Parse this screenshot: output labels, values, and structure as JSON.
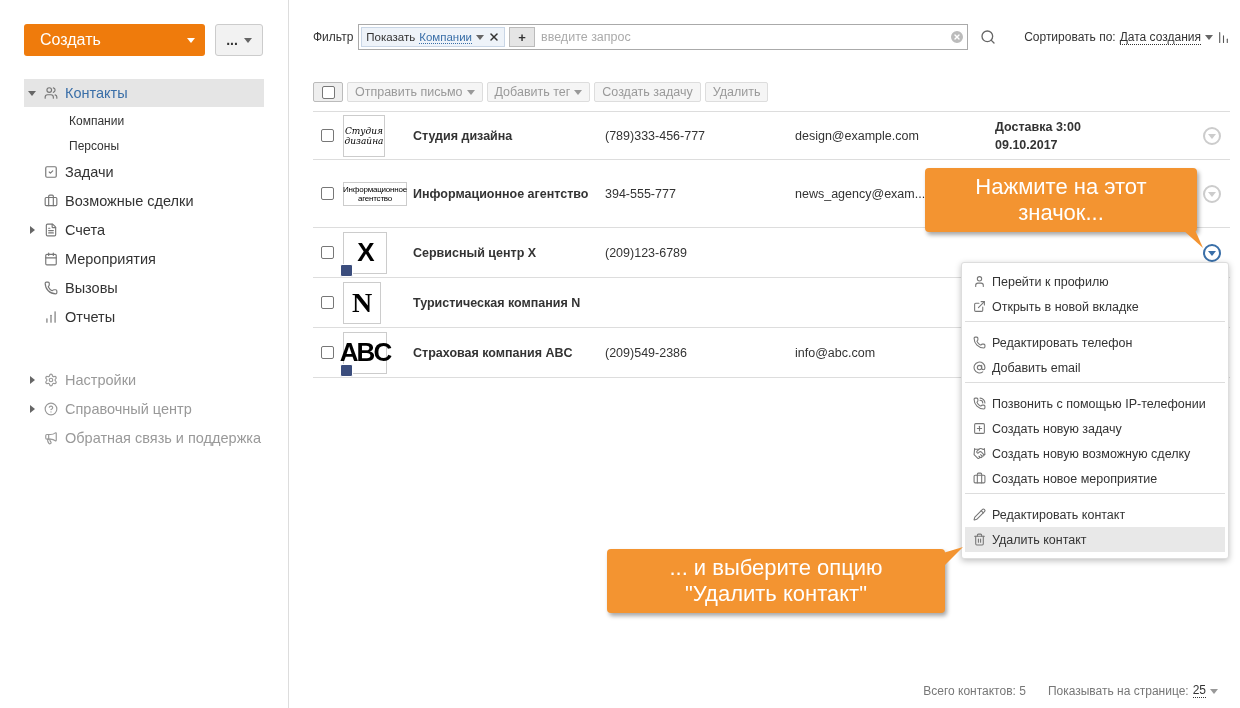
{
  "sidebar": {
    "create_button": "Создать",
    "more_button": "...",
    "sections": [
      {
        "dimmed": false,
        "items": [
          {
            "label": "Контакты",
            "selected": true,
            "expanded": true,
            "children": [
              {
                "label": "Компании",
                "selected": false
              },
              {
                "label": "Персоны",
                "selected": false
              }
            ]
          },
          {
            "label": "Задачи",
            "selected": false
          },
          {
            "label": "Возможные сделки",
            "selected": false
          },
          {
            "label": "Счета",
            "selected": false,
            "expanded": false
          },
          {
            "label": "Мероприятия",
            "selected": false
          },
          {
            "label": "Вызовы",
            "selected": false
          },
          {
            "label": "Отчеты",
            "selected": false
          }
        ]
      },
      {
        "dimmed": true,
        "items": [
          {
            "label": "Настройки",
            "selected": false,
            "expanded": false
          },
          {
            "label": "Справочный центр",
            "selected": false,
            "expanded": false
          },
          {
            "label": "Обратная связь и поддержка",
            "selected": false
          }
        ]
      }
    ]
  },
  "filter": {
    "label": "Фильтр",
    "tag": {
      "label": "Показать",
      "value": "Компании"
    },
    "add_button": "+",
    "placeholder": "введите запрос"
  },
  "sort": {
    "label": "Сортировать по:",
    "value": "Дата создания"
  },
  "toolbar": {
    "select_all": {
      "checked": false
    },
    "buttons": [
      {
        "label": "Отправить письмо",
        "dropdown": true,
        "disabled": true
      },
      {
        "label": "Добавить тег",
        "dropdown": true,
        "disabled": true
      },
      {
        "label": "Создать задачу",
        "dropdown": false,
        "disabled": true
      },
      {
        "label": "Удалить",
        "dropdown": false,
        "disabled": true
      }
    ]
  },
  "rows": [
    {
      "checked": false,
      "logo": {
        "text": "Студия дизайна",
        "kind": "script",
        "badge": false
      },
      "name": "Студия дизайна",
      "phone": "(789)333-456-777",
      "email": "design@example.com",
      "task": [
        "Доставка 3:00",
        "09.10.2017"
      ],
      "menu_open": false
    },
    {
      "checked": false,
      "logo": {
        "text": "Информационное агентство",
        "kind": "tiny",
        "badge": false
      },
      "name": "Информационное агентство",
      "phone": "394-555-777",
      "email": "news_agency@exam...",
      "menu_open": false
    },
    {
      "checked": false,
      "logo": {
        "text": "X",
        "kind": "sans",
        "badge": true
      },
      "name": "Сервисный центр X",
      "phone": "(209)123-6789",
      "menu_open": true
    },
    {
      "checked": false,
      "logo": {
        "text": "N",
        "kind": "serif",
        "badge": false
      },
      "name": "Туристическая компания N"
    },
    {
      "checked": false,
      "logo": {
        "text": "ABC",
        "kind": "sans",
        "badge": true
      },
      "name": "Страховая компания ABC",
      "phone": "(209)549-2386",
      "email": "info@abc.com"
    }
  ],
  "context_menu": {
    "groups": [
      [
        {
          "label": "Перейти к профилю",
          "selected": false
        },
        {
          "label": "Открыть в новой вкладке",
          "selected": false
        }
      ],
      [
        {
          "label": "Редактировать телефон",
          "selected": false
        },
        {
          "label": "Добавить email",
          "selected": false
        }
      ],
      [
        {
          "label": "Позвонить с помощью IP-телефонии",
          "selected": false
        },
        {
          "label": "Создать новую задачу",
          "selected": false
        },
        {
          "label": "Создать новую возможную сделку",
          "selected": false
        },
        {
          "label": "Создать новое мероприятие",
          "selected": false
        }
      ],
      [
        {
          "label": "Редактировать контакт",
          "selected": false
        },
        {
          "label": "Удалить контакт",
          "selected": true
        }
      ]
    ]
  },
  "callouts": [
    {
      "text": "Нажмите на этот значок...",
      "kind": "above"
    },
    {
      "text": "... и выберите опцию \"Удалить контакт\"",
      "kind": "beside"
    }
  ],
  "footer": {
    "total": "Всего контактов: 5",
    "per_page_label": "Показывать на странице:",
    "per_page": "25"
  }
}
